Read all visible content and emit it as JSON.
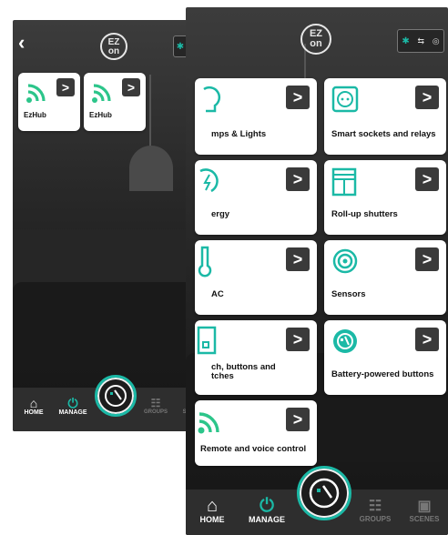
{
  "back_screen": {
    "logo_text": "EZ on",
    "hubs": [
      {
        "label": "EzHub"
      },
      {
        "label": "EzHub"
      }
    ],
    "tabs": [
      {
        "label": "HOME"
      },
      {
        "label": "MANAGE"
      },
      {
        "label": "GROUPS"
      },
      {
        "label": "SCENES"
      }
    ]
  },
  "front_screen": {
    "logo_text": "EZ on",
    "categories": [
      {
        "label": "mps & Lights"
      },
      {
        "label": "Smart sockets and relays"
      },
      {
        "label": "ergy"
      },
      {
        "label": "Roll-up shutters"
      },
      {
        "label": "AC"
      },
      {
        "label": "Sensors"
      },
      {
        "label": "ch, buttons and\ntches"
      },
      {
        "label": "Battery-powered buttons"
      },
      {
        "label": "Remote and voice control"
      }
    ],
    "tabs": [
      {
        "label": "HOME"
      },
      {
        "label": "MANAGE"
      },
      {
        "label": "GROUPS"
      },
      {
        "label": "SCENES"
      }
    ]
  },
  "chevron": ">",
  "accent_color": "#1bb9a6"
}
